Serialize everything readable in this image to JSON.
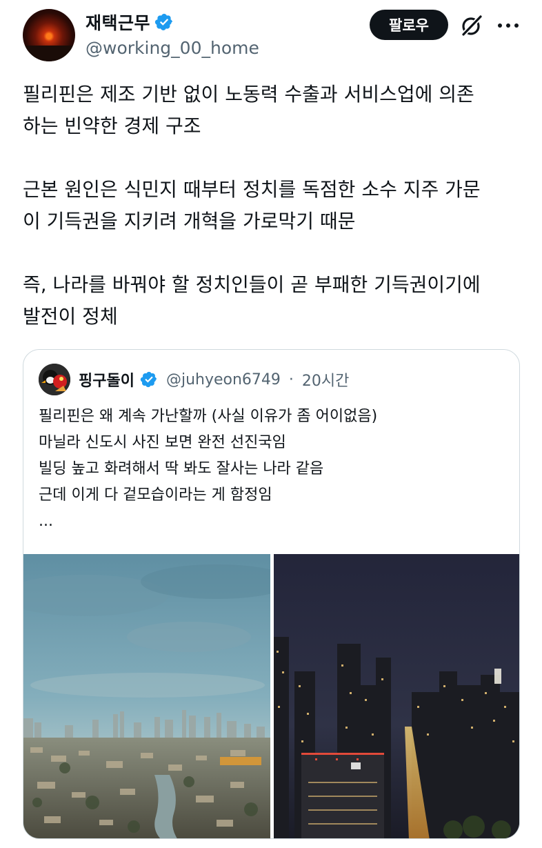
{
  "author": {
    "display_name": "재택근무",
    "handle": "@working_00_home"
  },
  "actions": {
    "follow_label": "팔로우"
  },
  "tweet": {
    "lines": [
      "필리핀은 제조 기반 없이 노동력 수출과 서비스업에 의존",
      "하는 빈약한 경제 구조",
      "",
      "근본 원인은 식민지 때부터 정치를 독점한 소수 지주 가문",
      "이 기득권을 지키려 개혁을 가로막기 때문",
      "",
      "즉, 나라를 바꿔야 할 정치인들이 곧 부패한 기득권이기에",
      "발전이 정체"
    ]
  },
  "quote": {
    "display_name": "핑구돌이",
    "handle": "@juhyeon6749",
    "separator": "·",
    "time": "20시간",
    "lines": [
      "필리핀은 왜 계속 가난할까 (사실 이유가 좀 어이없음)",
      "마닐라 신도시 사진 보면 완전 선진국임",
      "빌딩 높고 화려해서 딱 봐도 잘사는 나라 같음",
      "근데 이게 다 겉모습이라는 게 함정임",
      "..."
    ]
  },
  "icons": {
    "verified": "verified-badge-icon",
    "grok": "grok-icon",
    "more": "more-icon"
  },
  "colors": {
    "verified": "#1d9bf0",
    "follow_bg": "#0f1419",
    "secondary_text": "#536471"
  }
}
